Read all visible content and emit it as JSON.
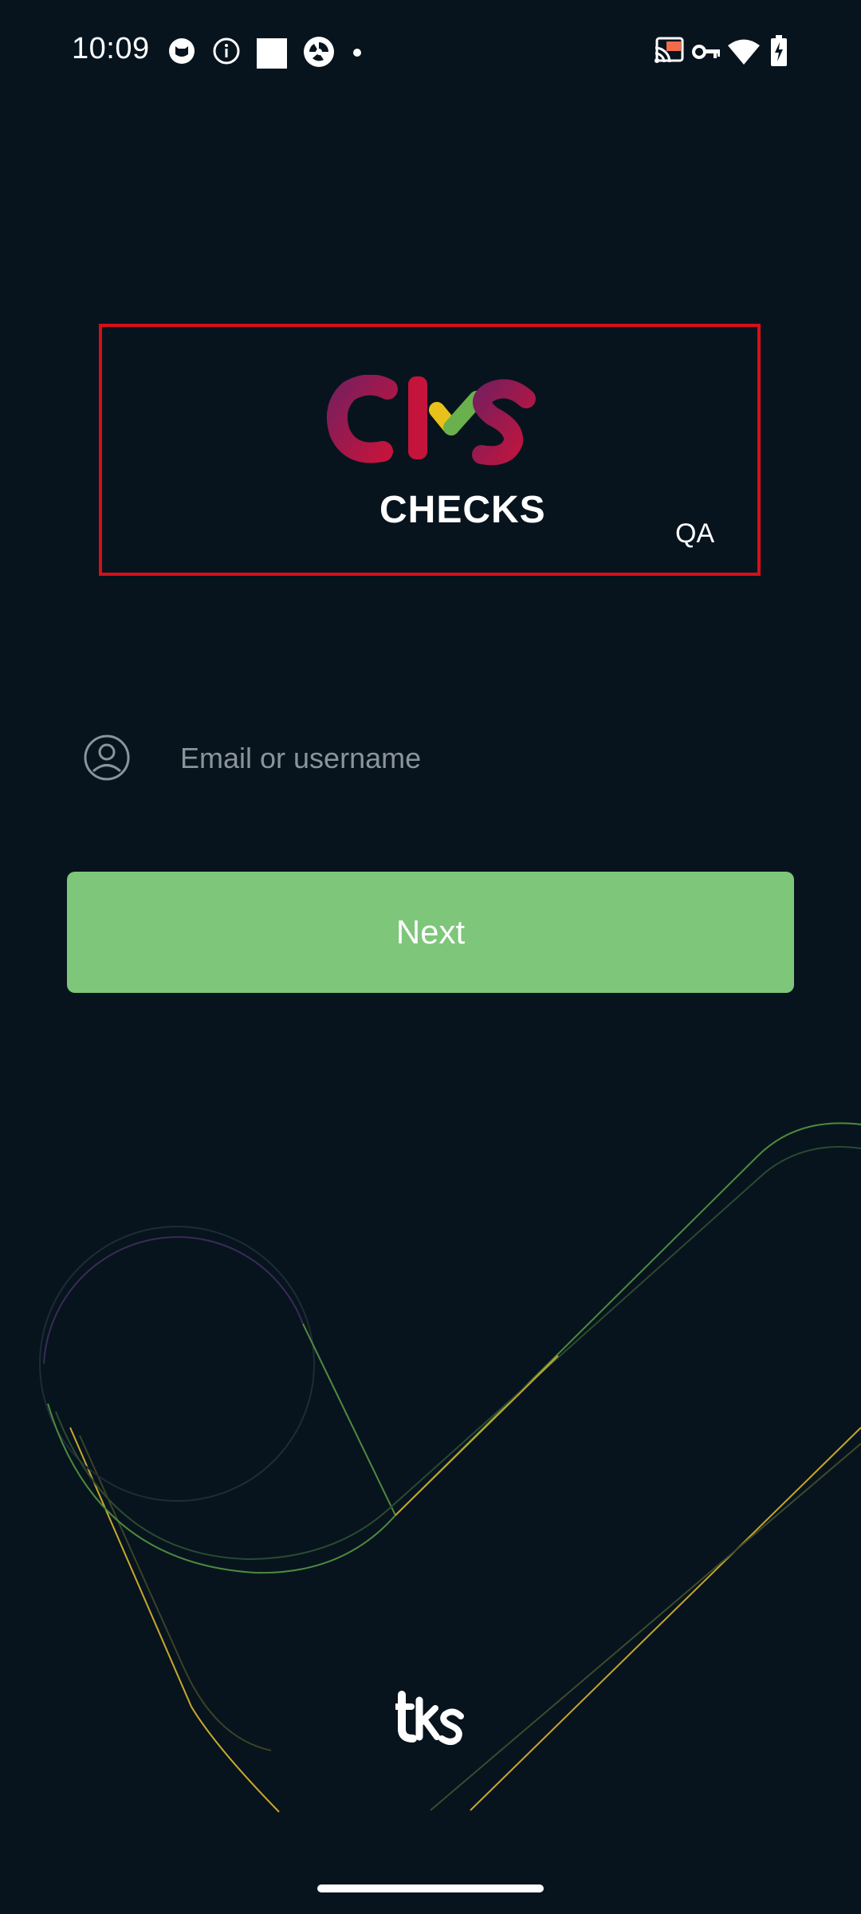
{
  "status_bar": {
    "time": "10:09",
    "left_icons": [
      "cat-face-icon",
      "info-icon",
      "square-app-icon",
      "shutter-app-icon",
      "notification-dot-icon"
    ],
    "right_icons": [
      "cast-icon",
      "vpn-key-icon",
      "wifi-icon",
      "battery-charging-icon"
    ]
  },
  "logo": {
    "wordmark": "CHECKS",
    "environment": "QA",
    "colors": {
      "crimson": "#c4143c",
      "purple": "#7a1e5c",
      "yellow": "#e8c21a",
      "green": "#6ab04c",
      "frame": "#d60f18"
    }
  },
  "login": {
    "email_placeholder": "Email or username",
    "email_value": "",
    "next_label": "Next"
  },
  "footer": {
    "logo_text": "tks"
  },
  "theme": {
    "background": "#07141e",
    "button": "#7dc67a",
    "placeholder": "#8a949b"
  }
}
